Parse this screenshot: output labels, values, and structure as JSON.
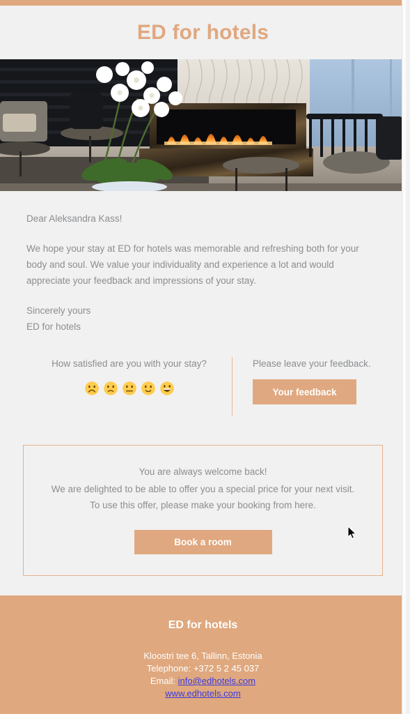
{
  "colors": {
    "accent": "#e0a880",
    "footer_bg": "#dfa87e",
    "page_bg": "#f1f1f1",
    "text": "#8b8d90",
    "link": "#3b3bdd",
    "border": "#e6b089"
  },
  "header": {
    "title": "ED for hotels"
  },
  "hero": {
    "alt": "hotel-lobby-fireplace-orchids"
  },
  "letter": {
    "salutation": "Dear Aleksandra Kass!",
    "body": "We hope your stay at ED for hotels was memorable and refreshing both for your body and soul. We value your individuality and experience a lot and would appreciate your feedback and impressions of your stay.",
    "signoff_line1": "Sincerely yours",
    "signoff_line2": "ED for hotels"
  },
  "survey": {
    "question": "How satisfied are you with your stay?",
    "ratings": [
      {
        "name": "frowning-face",
        "value": 1
      },
      {
        "name": "slightly-frowning-face",
        "value": 2
      },
      {
        "name": "neutral-face",
        "value": 3
      },
      {
        "name": "slightly-smiling-face",
        "value": 4
      },
      {
        "name": "grinning-face",
        "value": 5
      }
    ],
    "feedback_label": "Please leave your feedback.",
    "feedback_button": "Your feedback"
  },
  "offer": {
    "headline": "You are always welcome back!",
    "text": "We are delighted to be able to offer you a special price for your next visit. To use this offer, please make your booking from here.",
    "button": "Book a room"
  },
  "footer": {
    "brand": "ED for hotels",
    "address": "Kloostri tee 6, Tallinn, Estonia",
    "telephone": "Telephone: +372 5 2 45 037",
    "email_label": "Email: ",
    "email": "info@edhotels.com",
    "website": "www.edhotels.com"
  }
}
